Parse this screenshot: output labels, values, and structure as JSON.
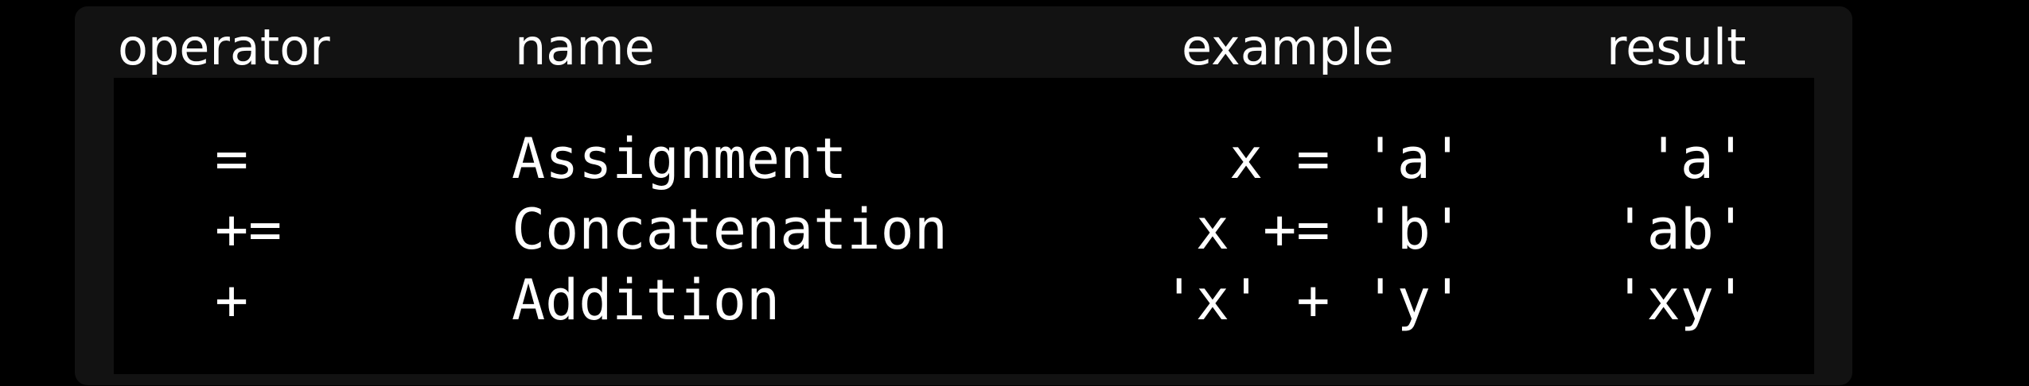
{
  "table": {
    "headers": {
      "operator": "operator",
      "name": "name",
      "example": "example",
      "result": "result"
    },
    "rows": [
      {
        "operator": "=",
        "name": "Assignment",
        "example": "x = 'a'",
        "result": "'a'"
      },
      {
        "operator": "+=",
        "name": "Concatenation",
        "example": "x += 'b'",
        "result": "'ab'"
      },
      {
        "operator": "+",
        "name": "Addition",
        "example": "'x' + 'y'",
        "result": "'xy'"
      }
    ]
  },
  "colors": {
    "background": "#000000",
    "panel": "#121212",
    "text": "#ffffff"
  }
}
